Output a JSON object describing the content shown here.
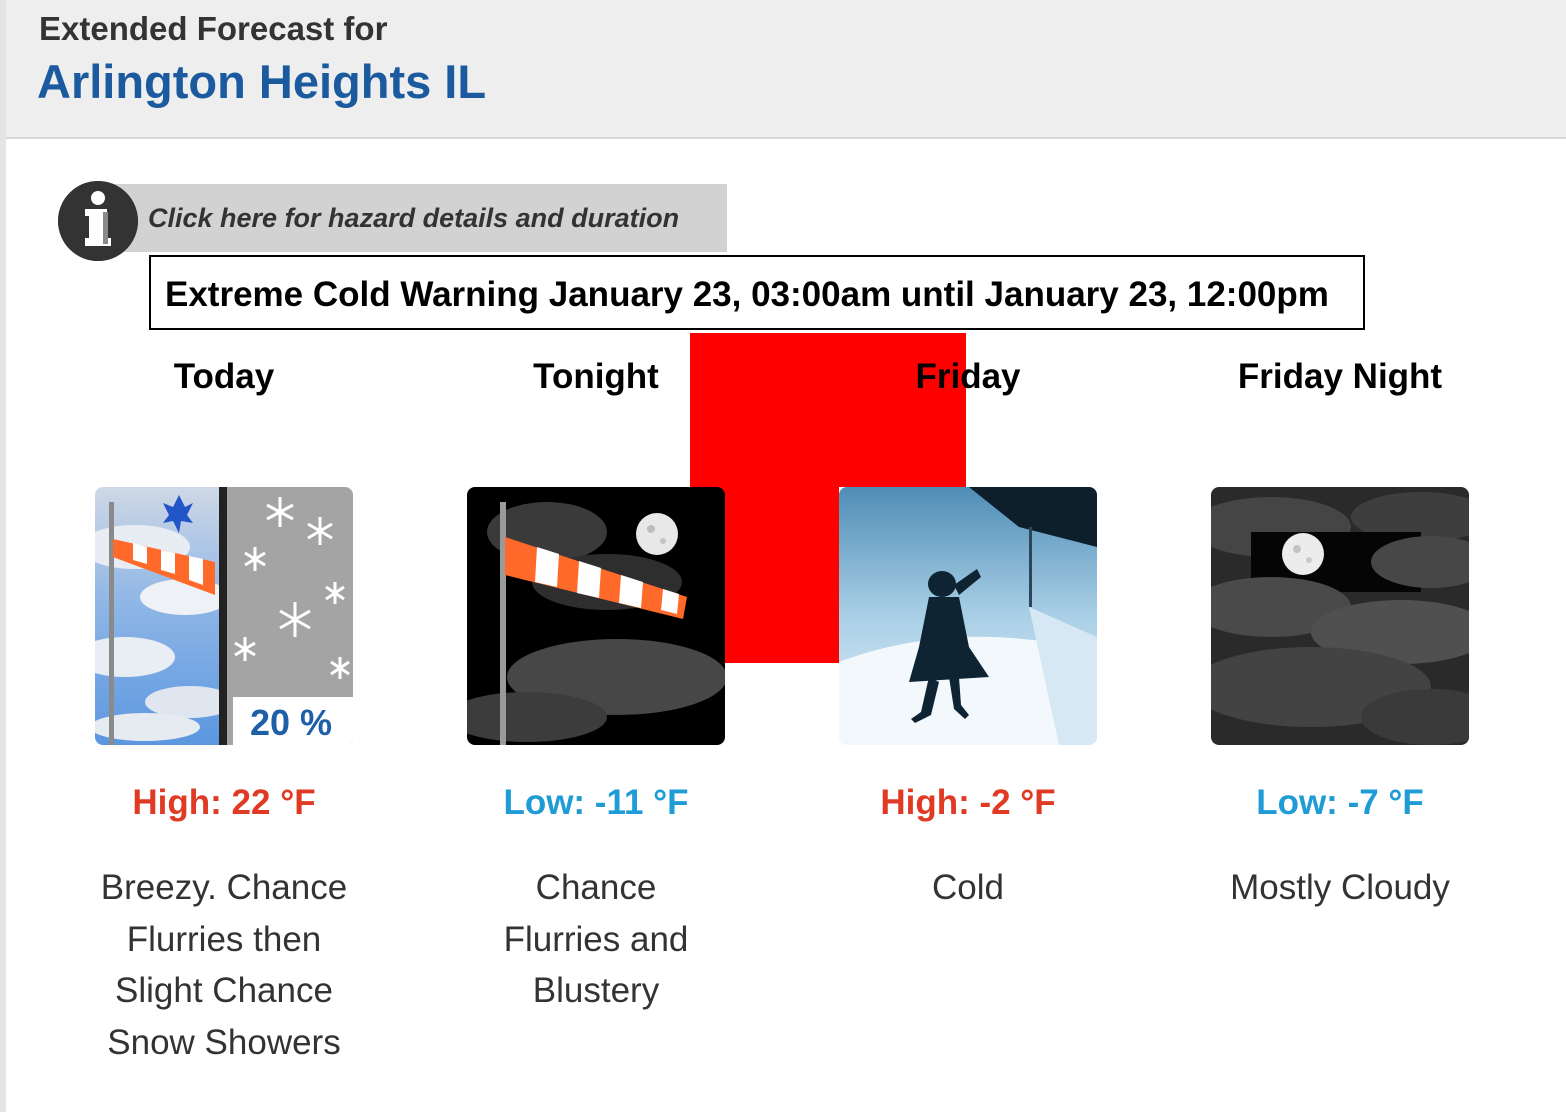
{
  "header": {
    "subtitle": "Extended Forecast for",
    "location": "Arlington Heights IL"
  },
  "hazard": {
    "link_text": "Click here for hazard details and duration",
    "icon": "info-icon",
    "warning_text": "Extreme Cold Warning January 23, 03:00am until January 23, 12:00pm"
  },
  "colors": {
    "high_temp": "#e03a24",
    "low_temp": "#1f9bd6",
    "location_title": "#1b5a9e",
    "overlay": "#ff0000"
  },
  "periods": [
    {
      "name": "Today",
      "icon": "windy-snow-icon",
      "icon_label": "20 %",
      "temperature": "High: 22 °F",
      "temp_kind": "high",
      "description": "Breezy. Chance Flurries then Slight Chance Snow Showers"
    },
    {
      "name": "Tonight",
      "icon": "windy-night-icon",
      "icon_label": "",
      "temperature": "Low: -11 °F",
      "temp_kind": "low",
      "description": "Chance Flurries and Blustery"
    },
    {
      "name": "Friday",
      "icon": "cold-icon",
      "icon_label": "",
      "temperature": "High: -2 °F",
      "temp_kind": "high",
      "description": "Cold"
    },
    {
      "name": "Friday Night",
      "icon": "cloudy-night-icon",
      "icon_label": "",
      "temperature": "Low: -7 °F",
      "temp_kind": "low",
      "description": "Mostly Cloudy"
    }
  ]
}
